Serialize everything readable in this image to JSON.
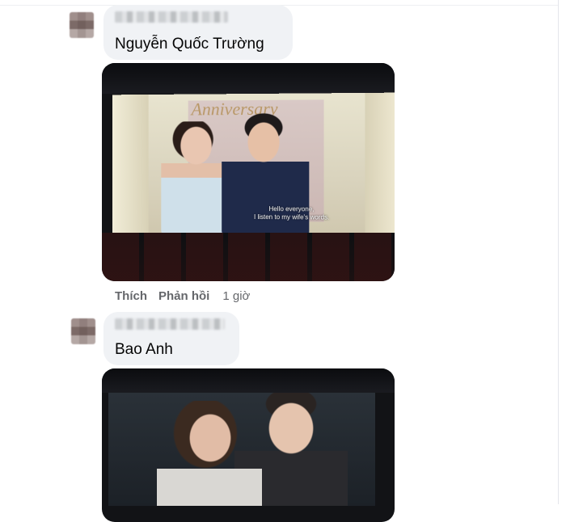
{
  "comments": [
    {
      "author": "Nguyễn Quốc Trường",
      "actions": {
        "like_label": "Thích",
        "reply_label": "Phản hồi",
        "time": "1 giờ"
      },
      "photo": {
        "banner_text": "Anniversary",
        "subtitle_line1": "Hello everyone,",
        "subtitle_line2": "I listen to my wife's words."
      }
    },
    {
      "author": "Bao Anh"
    }
  ]
}
